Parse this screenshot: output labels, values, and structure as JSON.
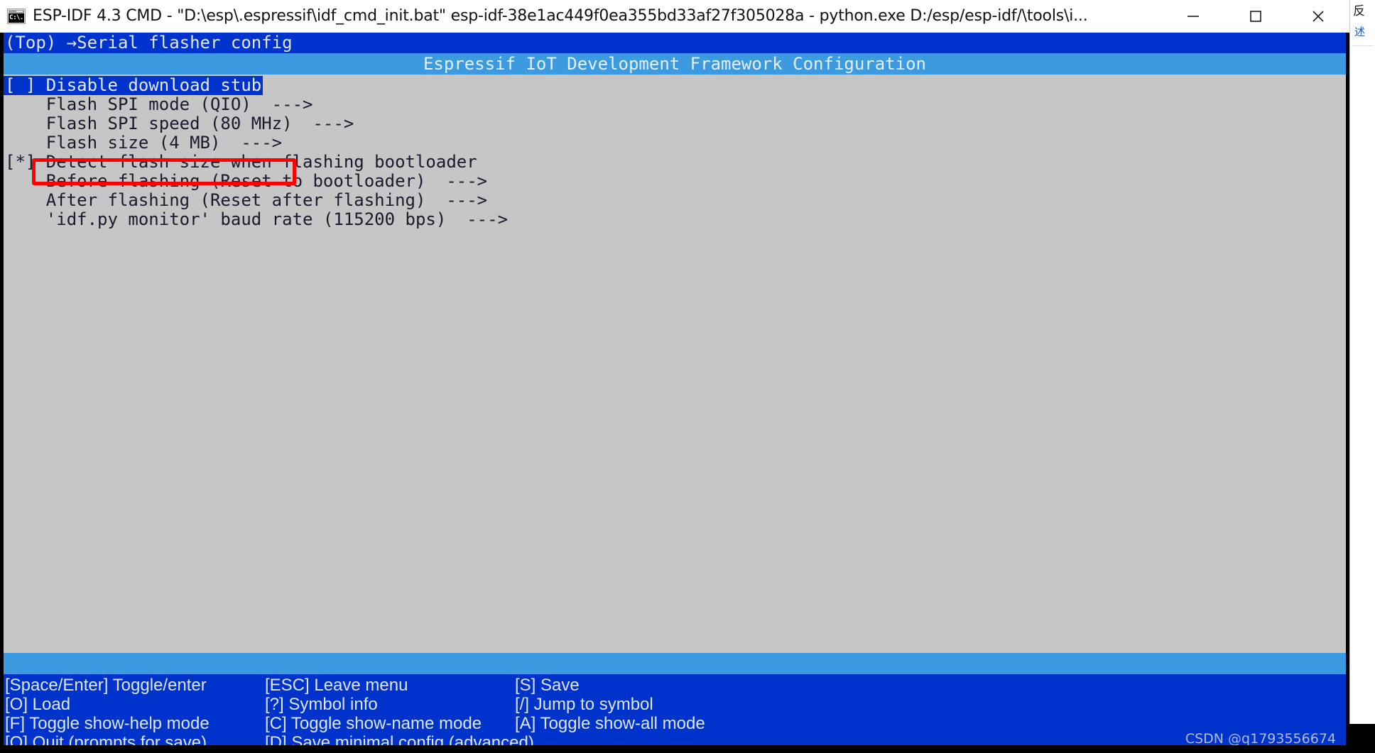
{
  "window": {
    "icon_name": "cmd-prompt-icon",
    "icon_glyph": "C:\\.",
    "title": "ESP-IDF 4.3 CMD - \"D:\\esp\\.espressif\\idf_cmd_init.bat\"  esp-idf-38e1ac449f0ea355bd33af27f305028a - python.exe  D:/esp/esp-idf/\\tools\\i...",
    "minimize_label": "Minimize",
    "maximize_label": "Maximize",
    "close_label": "Close"
  },
  "kconfig": {
    "breadcrumb": "(Top) →Serial flasher config",
    "banner": "Espressif IoT Development Framework Configuration",
    "menu_items": [
      {
        "prefix": "[ ] ",
        "label": "Disable download stub",
        "suffix": "",
        "selected": true
      },
      {
        "prefix": "    ",
        "label": "Flash SPI mode (QIO)",
        "suffix": "  --->",
        "selected": false
      },
      {
        "prefix": "    ",
        "label": "Flash SPI speed (80 MHz)",
        "suffix": "  --->",
        "selected": false
      },
      {
        "prefix": "    ",
        "label": "Flash size (4 MB)",
        "suffix": "  --->",
        "selected": false
      },
      {
        "prefix": "[*] ",
        "label": "Detect flash size when flashing bootloader",
        "suffix": "",
        "selected": false
      },
      {
        "prefix": "    ",
        "label": "Before flashing (Reset to bootloader)",
        "suffix": "  --->",
        "selected": false
      },
      {
        "prefix": "    ",
        "label": "After flashing (Reset after flashing)",
        "suffix": "  --->",
        "selected": false
      },
      {
        "prefix": "    ",
        "label": "'idf.py monitor' baud rate (115200 bps)",
        "suffix": "  --->",
        "selected": false
      }
    ],
    "annotation": {
      "name": "red-highlight-box",
      "color": "#ff0000",
      "targets_item": "Flash size (4 MB)"
    }
  },
  "help_bar": {
    "rows": [
      {
        "c1": "[Space/Enter] Toggle/enter",
        "c2": "[ESC] Leave menu",
        "c3": "[S] Save"
      },
      {
        "c1": "[O] Load",
        "c2": "[?] Symbol info",
        "c3": "[/] Jump to symbol"
      },
      {
        "c1": "[F] Toggle show-help mode",
        "c2": "[C] Toggle show-name mode",
        "c3": "[A] Toggle show-all mode"
      },
      {
        "c1": "[Q] Quit (prompts for save)",
        "c2": "[D] Save minimal config (advanced)",
        "c3": ""
      }
    ]
  },
  "watermark": {
    "text": "CSDN @q1793556674"
  },
  "background": {
    "right_window_title": "反",
    "right_window_sub": "述"
  },
  "colors": {
    "terminal_bg": "#c6c6c6",
    "selection_blue": "#0033cc",
    "banner_blue": "#3c9ae0",
    "annotation_red": "#ff0000",
    "text_dark": "#1a1a2e",
    "text_light": "#dfe6ff"
  }
}
